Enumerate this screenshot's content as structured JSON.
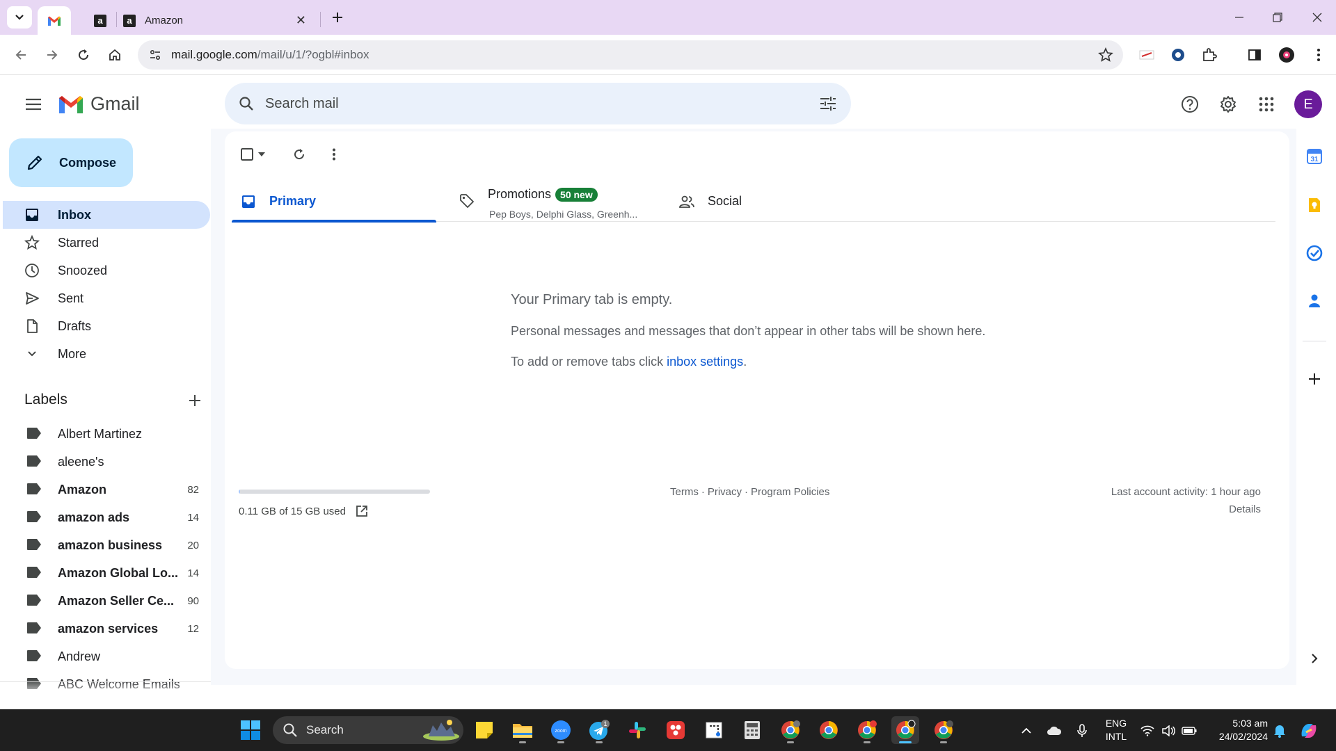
{
  "browser": {
    "tabs": [
      {
        "title": "",
        "favicon": "gmail-icon",
        "active": true
      },
      {
        "title": "",
        "favicon": "amazon-icon",
        "active": false
      },
      {
        "title": "Amazon",
        "favicon": "amazon-icon",
        "active": false
      }
    ],
    "url_host": "mail.google.com",
    "url_path": "/mail/u/1/?ogbl#inbox"
  },
  "gmail": {
    "logo_text": "Gmail",
    "search_placeholder": "Search mail",
    "avatar_initial": "E",
    "compose_label": "Compose",
    "nav": [
      {
        "label": "Inbox",
        "icon": "inbox-icon",
        "active": true
      },
      {
        "label": "Starred",
        "icon": "star-icon"
      },
      {
        "label": "Snoozed",
        "icon": "clock-icon"
      },
      {
        "label": "Sent",
        "icon": "send-icon"
      },
      {
        "label": "Drafts",
        "icon": "draft-icon"
      },
      {
        "label": "More",
        "icon": "chevron-down-icon"
      }
    ],
    "labels_heading": "Labels",
    "labels": [
      {
        "name": "Albert Martinez",
        "count": "",
        "bold": false
      },
      {
        "name": "aleene's",
        "count": "",
        "bold": false
      },
      {
        "name": "Amazon",
        "count": "82",
        "bold": true
      },
      {
        "name": "amazon ads",
        "count": "14",
        "bold": true
      },
      {
        "name": "amazon business",
        "count": "20",
        "bold": true
      },
      {
        "name": "Amazon Global Lo...",
        "count": "14",
        "bold": true
      },
      {
        "name": "Amazon Seller Ce...",
        "count": "90",
        "bold": true
      },
      {
        "name": "amazon services",
        "count": "12",
        "bold": true
      },
      {
        "name": "Andrew",
        "count": "",
        "bold": false
      },
      {
        "name": "ABC Welcome Emails",
        "count": "",
        "bold": false
      }
    ],
    "tabs": {
      "primary": "Primary",
      "promotions": "Promotions",
      "promotions_badge": "50 new",
      "promotions_senders": "Pep Boys, Delphi Glass, Greenh...",
      "social": "Social"
    },
    "empty": {
      "title": "Your Primary tab is empty.",
      "line1": "Personal messages and messages that don’t appear in other tabs will be shown here.",
      "line2_prefix": "To add or remove tabs click ",
      "line2_link": "inbox settings",
      "line2_suffix": "."
    },
    "footer": {
      "storage": "0.11 GB of 15 GB used",
      "storage_fraction": 0.007,
      "terms": "Terms",
      "privacy": "Privacy",
      "policies": "Program Policies",
      "sep": "·",
      "activity": "Last account activity: 1 hour ago",
      "details": "Details"
    },
    "side_panel": {
      "calendar_day": "31"
    }
  },
  "taskbar": {
    "search_label": "Search",
    "language_line1": "ENG",
    "language_line2": "INTL",
    "time": "5:03 am",
    "date": "24/02/2024",
    "telegram_badge": "1",
    "zoom_label": "zoom"
  },
  "colors": {
    "gmail_blue": "#0b57d0",
    "compose_bg": "#c2e7ff",
    "active_nav_bg": "#d3e3fd",
    "promo_badge": "#188038",
    "tabstrip_bg": "#e8d8f4",
    "avatar_bg": "#6a1b9a"
  }
}
